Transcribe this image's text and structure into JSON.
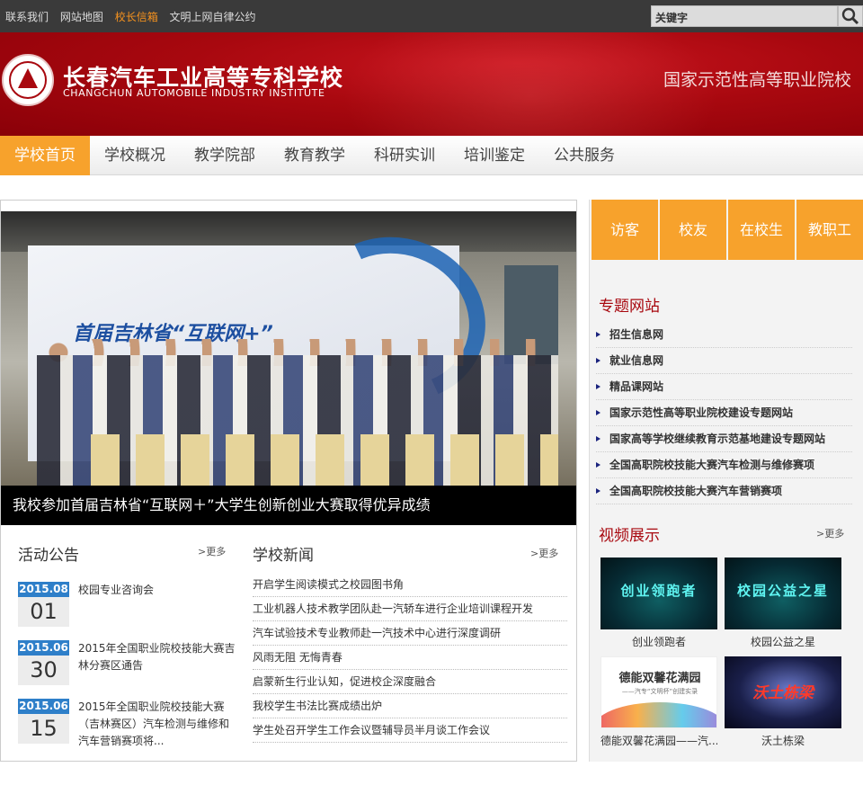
{
  "topbar": {
    "links": [
      "联系我们",
      "网站地图",
      "校长信箱",
      "文明上网自律公约"
    ],
    "highlight_color": "#f7931e",
    "search_placeholder": "关键字"
  },
  "header": {
    "name_cn": "长春汽车工业高等专科学校",
    "name_en": "CHANGCHUN AUTOMOBILE INDUSTRY INSTITUTE",
    "slogan": "国家示范性高等职业院校",
    "brand_color": "#a8080f"
  },
  "nav": {
    "items": [
      "学校首页",
      "学校概况",
      "教学院部",
      "教育教学",
      "科研实训",
      "培训鉴定",
      "公共服务"
    ],
    "active_index": 0,
    "accent": "#f7a22c"
  },
  "slider": {
    "photo_headline": "首届吉林省“互联网+”",
    "caption": "我校参加首届吉林省“互联网＋”大学生创新创业大赛取得优异成绩"
  },
  "notices": {
    "title": "活动公告",
    "more": ">更多",
    "items": [
      {
        "ym": "2015.08",
        "day": "01",
        "text": "校园专业咨询会"
      },
      {
        "ym": "2015.06",
        "day": "30",
        "text": "2015年全国职业院校技能大赛吉林分赛区通告"
      },
      {
        "ym": "2015.06",
        "day": "15",
        "text": "2015年全国职业院校技能大赛（吉林赛区）汽车检测与维修和汽车营销赛项将..."
      }
    ]
  },
  "news": {
    "title": "学校新闻",
    "more": ">更多",
    "items": [
      "开启学生阅读模式之校园图书角",
      "工业机器人技术教学团队赴一汽轿车进行企业培训课程开发",
      "汽车试验技术专业教师赴一汽技术中心进行深度调研",
      "风雨无阻 无悔青春",
      "启蒙新生行业认知，促进校企深度融合",
      "我校学生书法比赛成绩出炉",
      "学生处召开学生工作会议暨辅导员半月谈工作会议"
    ]
  },
  "user_buttons": [
    "访客",
    "校友",
    "在校生",
    "教职工"
  ],
  "special_sites": {
    "title": "专题网站",
    "items": [
      "招生信息网",
      "就业信息网",
      "精品课网站",
      "国家示范性高等职业院校建设专题网站",
      "国家高等学校继续教育示范基地建设专题网站",
      "全国高职院校技能大赛汽车检测与维修赛项",
      "全国高职院校技能大赛汽车营销赛项"
    ]
  },
  "videos": {
    "title": "视频展示",
    "more": ">更多",
    "items": [
      {
        "thumb_text": "创业领跑者",
        "caption": "创业领跑者"
      },
      {
        "thumb_text": "校园公益之星",
        "caption": "校园公益之星"
      },
      {
        "thumb_text": "德能双馨花满园",
        "thumb_sub": "——汽专“文明杯”创建实录",
        "caption": "德能双馨花满园——汽..."
      },
      {
        "thumb_text": "沃土栋梁",
        "caption": "沃土栋梁"
      }
    ]
  }
}
